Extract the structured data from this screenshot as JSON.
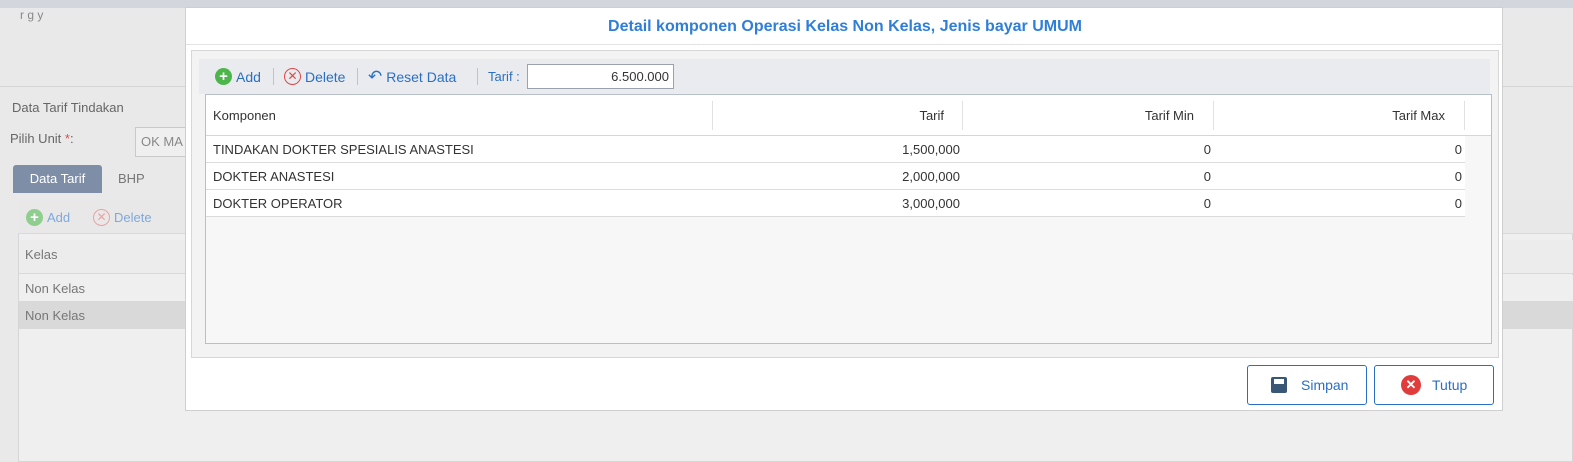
{
  "background": {
    "topbar_text": "r        g        y",
    "section_title": "Data Tarif Tindakan",
    "unit_label": "Pilih Unit",
    "unit_required": "*",
    "unit_label_suffix": ":",
    "unit_value": "OK MA",
    "tabs": [
      "Data Tarif",
      "BHP"
    ],
    "toolbar": {
      "add": "Add",
      "delete": "Delete"
    },
    "grid_header": "Kelas",
    "rows": [
      "Non Kelas",
      "Non Kelas"
    ]
  },
  "modal": {
    "title": "Detail komponen Operasi Kelas Non Kelas, Jenis bayar UMUM",
    "toolbar": {
      "add": "Add",
      "delete": "Delete",
      "reset": "Reset Data",
      "tarif_label": "Tarif :",
      "tarif_value": "6.500.000"
    },
    "grid": {
      "columns": [
        "Komponen",
        "Tarif",
        "Tarif Min",
        "Tarif Max"
      ],
      "rows": [
        {
          "komponen": "TINDAKAN DOKTER SPESIALIS ANASTESI",
          "tarif": "1,500,000",
          "tarif_min": "0",
          "tarif_max": "0"
        },
        {
          "komponen": "DOKTER ANASTESI",
          "tarif": "2,000,000",
          "tarif_min": "0",
          "tarif_max": "0"
        },
        {
          "komponen": "DOKTER OPERATOR",
          "tarif": "3,000,000",
          "tarif_min": "0",
          "tarif_max": "0"
        }
      ]
    },
    "buttons": {
      "save": "Simpan",
      "close": "Tutup"
    }
  },
  "colors": {
    "accent": "#2f7fd8",
    "add": "#4cb64c",
    "delete": "#e04848",
    "tab_active": "#7e8ea6"
  }
}
